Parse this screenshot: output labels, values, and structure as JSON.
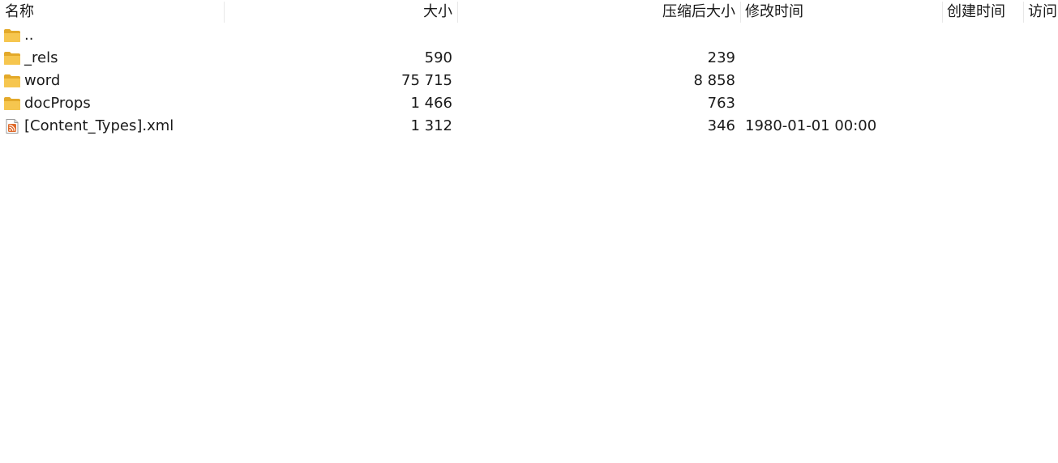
{
  "columns": {
    "name": "名称",
    "size": "大小",
    "packed_size": "压缩后大小",
    "modified": "修改时间",
    "created": "创建时间",
    "accessed": "访问"
  },
  "rows": [
    {
      "name": "..",
      "size": "",
      "packed_size": "",
      "modified": "",
      "created": "",
      "accessed": "",
      "icon": "folder-icon"
    },
    {
      "name": "_rels",
      "size": "590",
      "packed_size": "239",
      "modified": "",
      "created": "",
      "accessed": "",
      "icon": "folder-icon"
    },
    {
      "name": "word",
      "size": "75 715",
      "packed_size": "8 858",
      "modified": "",
      "created": "",
      "accessed": "",
      "icon": "folder-icon"
    },
    {
      "name": "docProps",
      "size": "1 466",
      "packed_size": "763",
      "modified": "",
      "created": "",
      "accessed": "",
      "icon": "folder-icon"
    },
    {
      "name": "[Content_Types].xml",
      "size": "1 312",
      "packed_size": "346",
      "modified": "1980-01-01 00:00",
      "created": "",
      "accessed": "",
      "icon": "xml-file-icon"
    }
  ],
  "colors": {
    "folder": "#f6c64f",
    "folder_dark": "#e3a92a",
    "xml_accent": "#e06a2b",
    "divider": "#e8e8e8",
    "text": "#1a1a1a"
  }
}
